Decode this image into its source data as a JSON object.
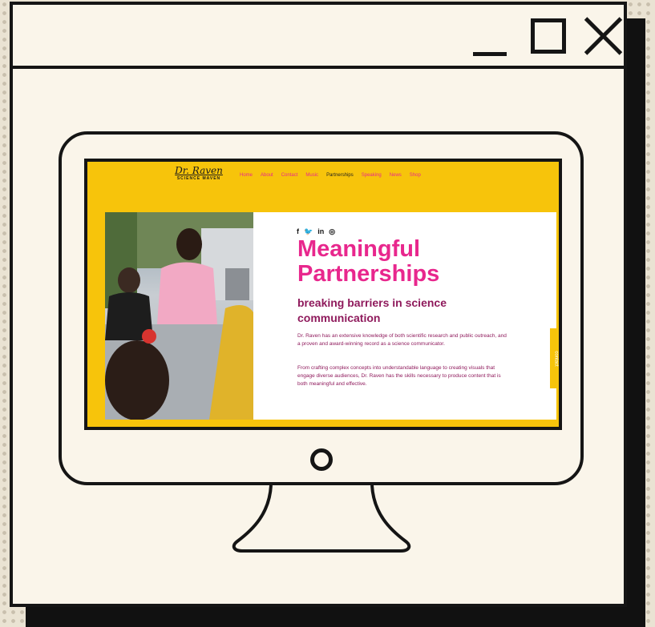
{
  "window": {
    "controls": [
      "minimize",
      "maximize",
      "close"
    ]
  },
  "site": {
    "logo": {
      "script": "Dr. Raven",
      "subtitle": "SCIENCE MAVEN"
    },
    "nav": [
      "Home",
      "About",
      "Contact",
      "Music",
      "Partnerships",
      "Speaking",
      "News",
      "Shop"
    ],
    "active_nav": "Partnerships",
    "social": [
      "f",
      "🐦",
      "in",
      "◎"
    ],
    "social_icons": [
      "facebook-icon",
      "twitter-icon",
      "linkedin-icon",
      "instagram-icon"
    ],
    "headline_line1": "Meaningful",
    "headline_line2": "Partnerships",
    "subhead_line1": "breaking barriers in science",
    "subhead_line2": "communication",
    "paragraph1": "Dr. Raven has an extensive knowledge of both scientific research and public outreach, and a proven and award-winning record as a science communicator.",
    "paragraph2": "From crafting complex concepts into understandable language to creating visuals that engage diverse audiences, Dr. Raven has the skills necessary to produce content that is both meaningful and effective.",
    "contact_tab": "contact"
  },
  "colors": {
    "accent_pink": "#e8278d",
    "maroon": "#8f1a5c",
    "yellow": "#f7c40b",
    "ink": "#151515"
  }
}
